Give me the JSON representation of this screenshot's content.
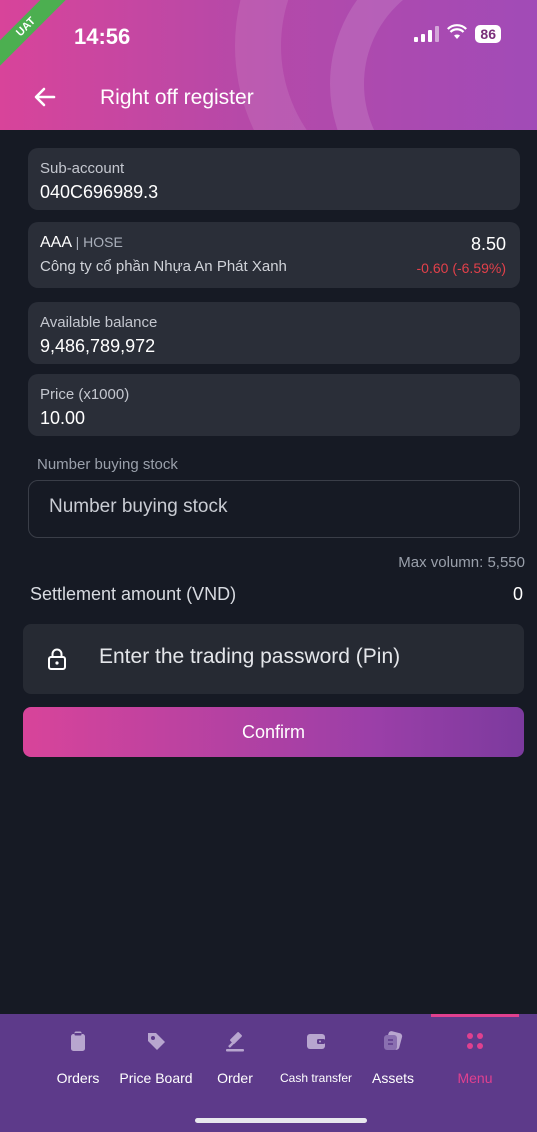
{
  "status": {
    "time": "14:56",
    "battery": "86",
    "badge": "UAT"
  },
  "header": {
    "title": "Right off register"
  },
  "sub_account": {
    "label": "Sub-account",
    "value": "040C696989.3"
  },
  "stock": {
    "symbol": "AAA",
    "exchange": "| HOSE",
    "company": "Công ty cổ phần Nhựa An Phát Xanh",
    "price": "8.50",
    "change": "-0.60 (-6.59%)",
    "change_color": "#e2404a"
  },
  "balance": {
    "label": "Available balance",
    "value": "9,486,789,972"
  },
  "price_field": {
    "label": "Price (x1000)",
    "value": "10.00"
  },
  "buy_input": {
    "label": "Number buying stock",
    "placeholder": "Number buying stock"
  },
  "max_volume": "Max volumn: 5,550",
  "settlement": {
    "label": "Settlement amount (VND)",
    "value": "0"
  },
  "pin": {
    "placeholder": "Enter the trading password (Pin)",
    "icon": "lock-icon"
  },
  "confirm_label": "Confirm",
  "nav": {
    "items": [
      {
        "label": "Orders",
        "icon": "clipboard-icon"
      },
      {
        "label": "Price Board",
        "icon": "tag-icon"
      },
      {
        "label": "Order",
        "icon": "gavel-icon"
      },
      {
        "label": "Cash transfer",
        "icon": "wallet-icon"
      },
      {
        "label": "Assets",
        "icon": "assets-icon"
      },
      {
        "label": "Menu",
        "icon": "menu-dots-icon",
        "active": true
      }
    ],
    "active_color": "#e0408f"
  },
  "theme": {
    "accent": "#d8449a",
    "background": "#161a24",
    "card": "#2a2e38"
  }
}
